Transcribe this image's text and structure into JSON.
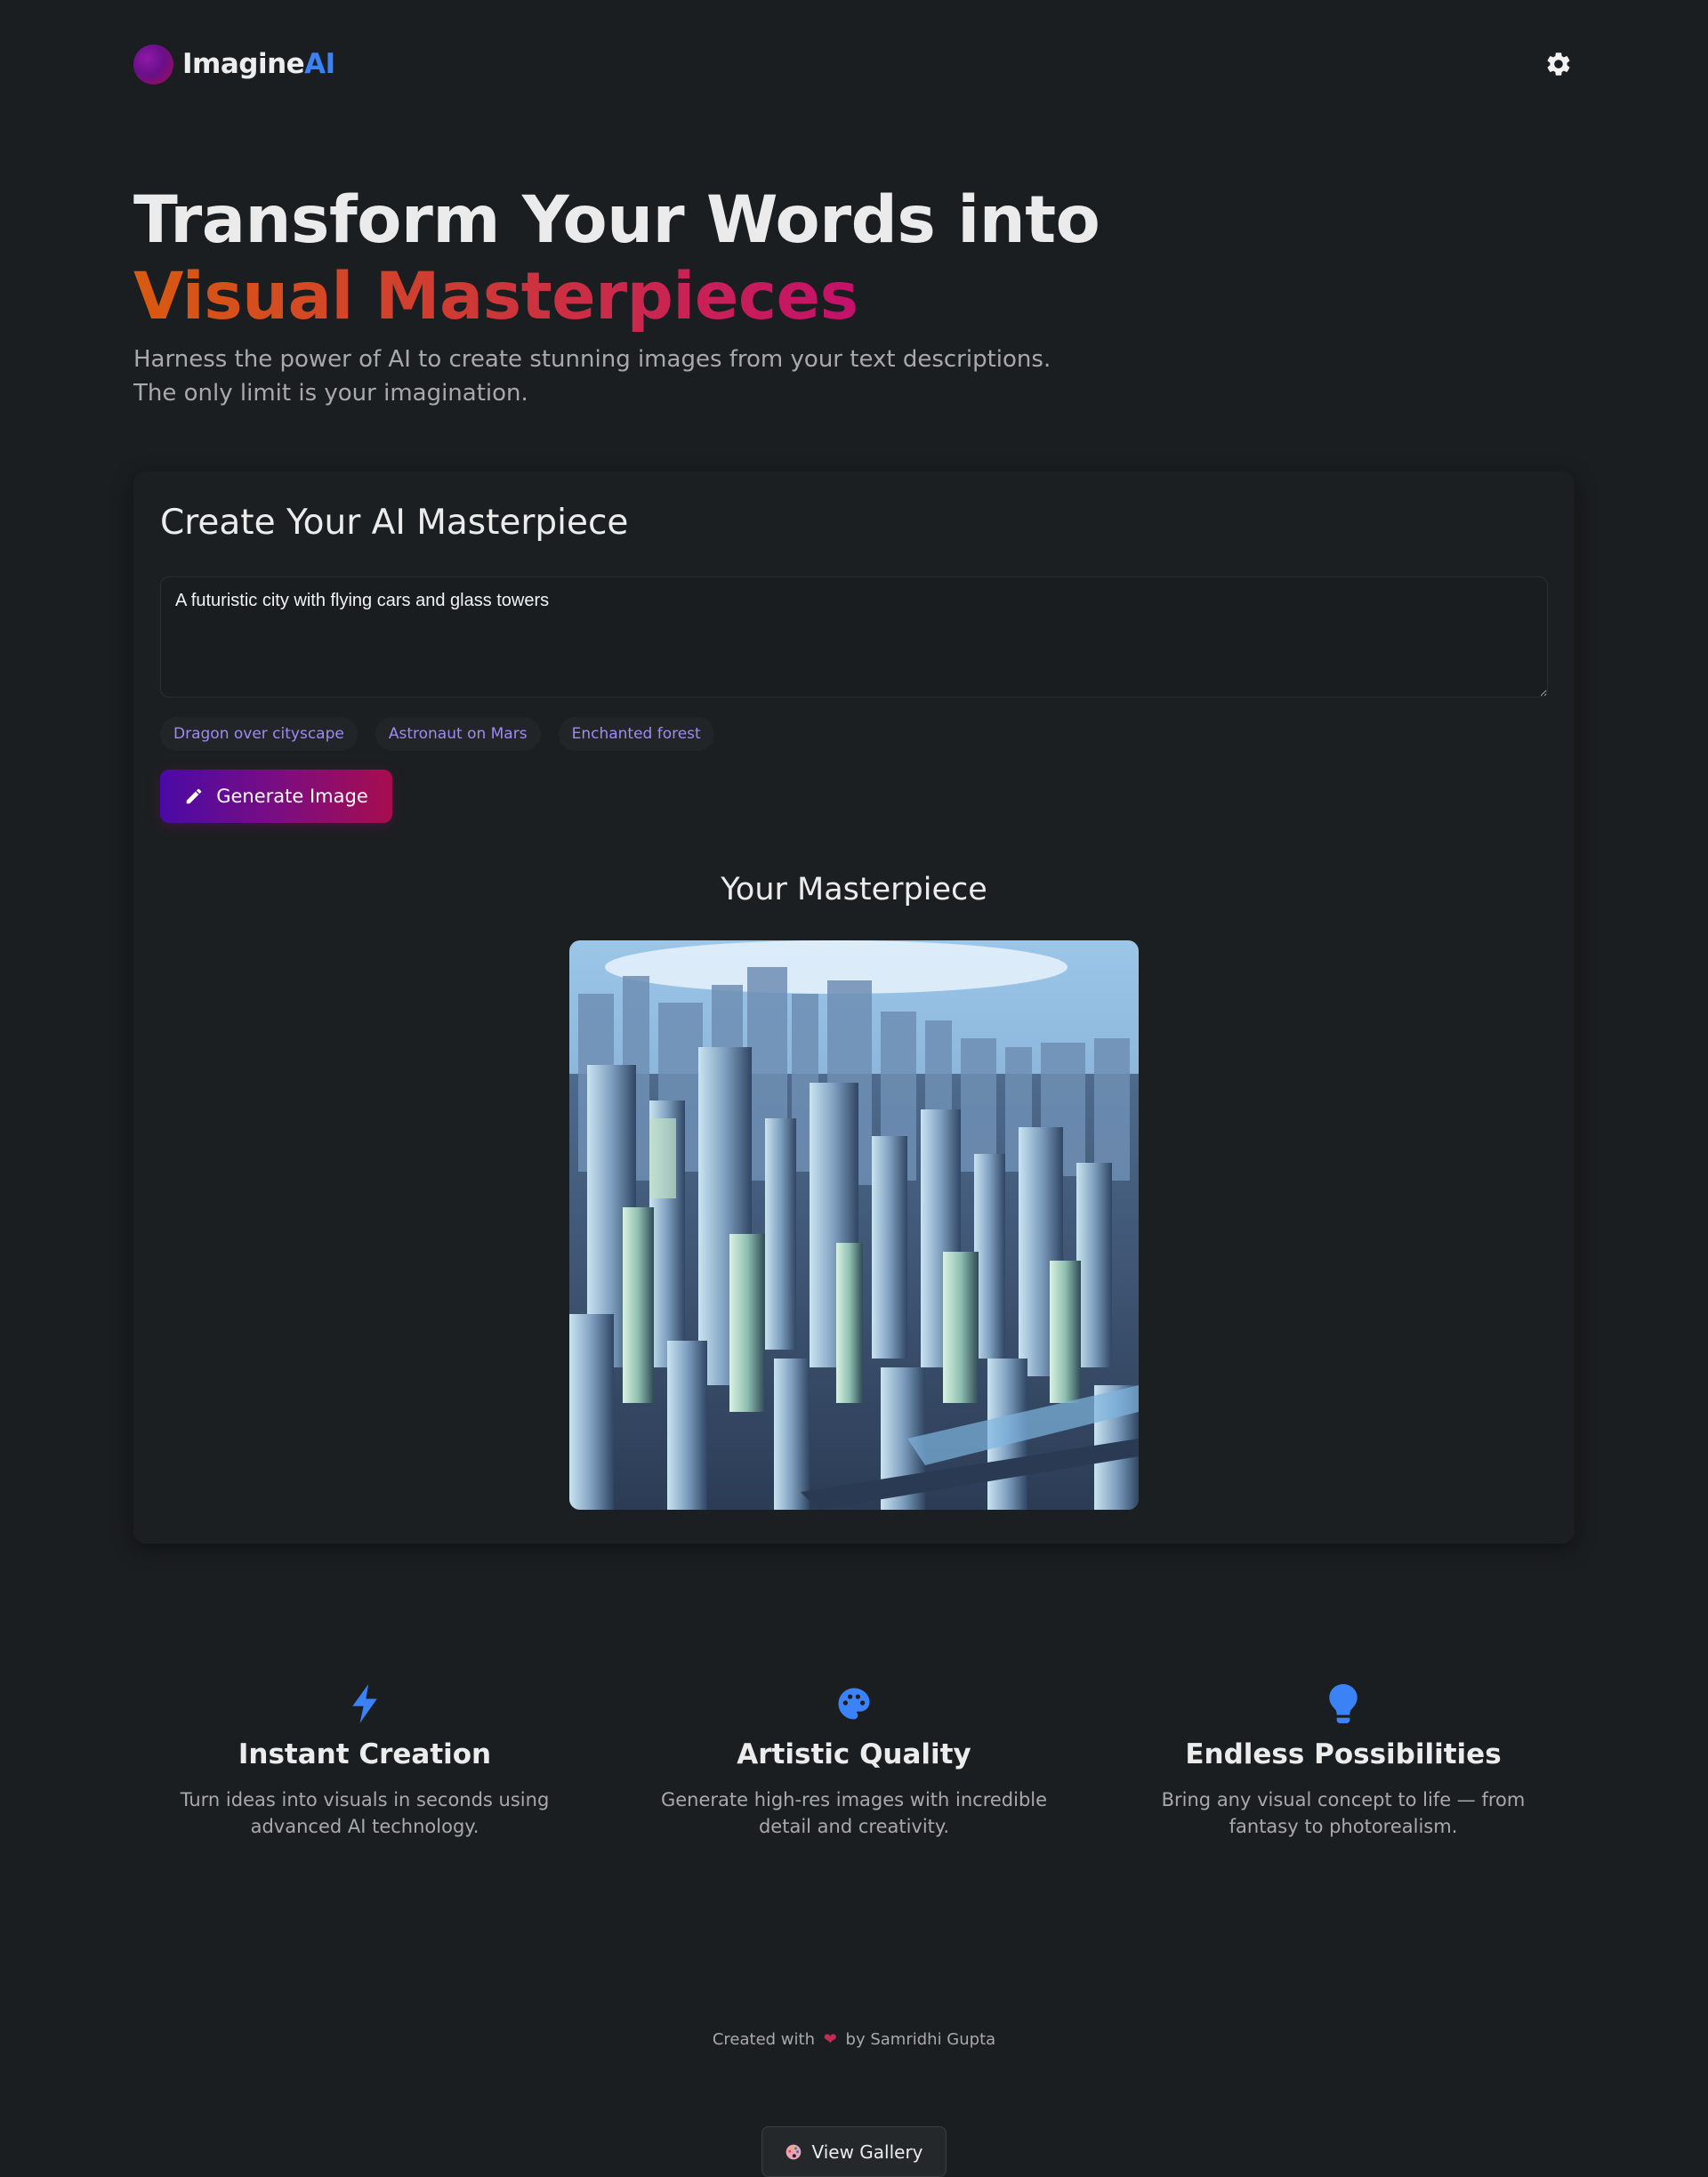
{
  "brand": {
    "name": "Imagine",
    "accent": "AI",
    "logo_icon": "orb-logo-icon"
  },
  "header": {
    "settings_icon": "gear-icon"
  },
  "hero": {
    "title_line1": "Transform Your Words into",
    "title_line2": "Visual Masterpieces",
    "subtitle": "Harness the power of AI to create stunning images from your text descriptions. The only limit is your imagination."
  },
  "generator": {
    "title": "Create Your AI Masterpiece",
    "prompt_value": "A futuristic city with flying cars and glass towers",
    "suggestions": [
      "Dragon over cityscape",
      "Astronaut on Mars",
      "Enchanted forest"
    ],
    "generate_label": "Generate Image",
    "generate_icon": "pencil-icon",
    "result_title": "Your Masterpiece"
  },
  "features": [
    {
      "icon": "bolt-icon",
      "title": "Instant Creation",
      "desc": "Turn ideas into visuals in seconds using advanced AI technology."
    },
    {
      "icon": "palette-icon",
      "title": "Artistic Quality",
      "desc": "Generate high-res images with incredible detail and creativity."
    },
    {
      "icon": "lightbulb-icon",
      "title": "Endless Possibilities",
      "desc": "Bring any visual concept to life — from fantasy to photorealism."
    }
  ],
  "footer": {
    "credit_prefix": "Created with",
    "credit_suffix": "by Samridhi Gupta",
    "gallery_label": "View Gallery",
    "gallery_icon": "palette-icon"
  },
  "colors": {
    "background": "#1b1e20",
    "brand_accent": "#3b82f6",
    "chip_text": "#9b8cf4",
    "feature_icon": "#3b82f6",
    "heart": "#c42a56"
  }
}
